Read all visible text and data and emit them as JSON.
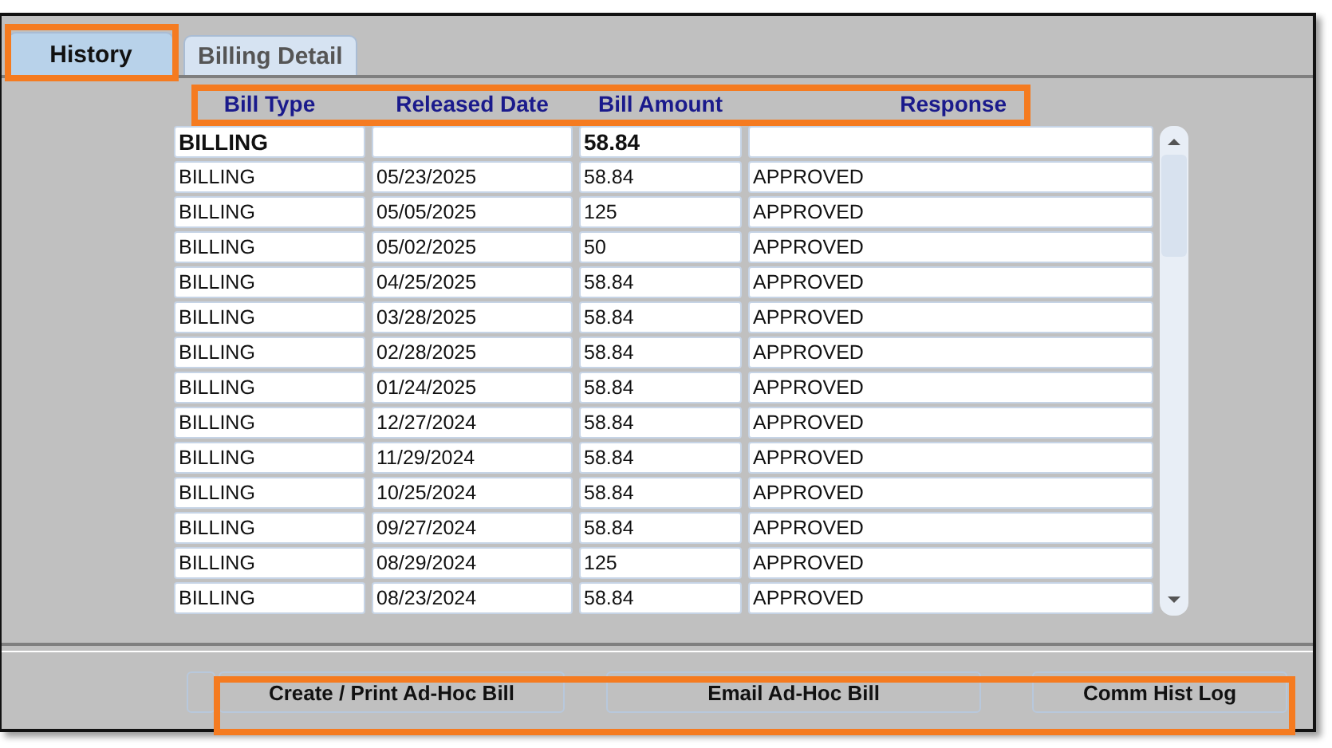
{
  "tabs": [
    {
      "label": "History",
      "selected": true
    },
    {
      "label": "Billing Detail",
      "selected": false
    }
  ],
  "table": {
    "columns": [
      "Bill Type",
      "Released Date",
      "Bill Amount",
      "Response"
    ],
    "rows": [
      {
        "bold": true,
        "cells": [
          "BILLING",
          "",
          "58.84",
          ""
        ]
      },
      {
        "bold": false,
        "cells": [
          "BILLING",
          "05/23/2025",
          "58.84",
          "APPROVED"
        ]
      },
      {
        "bold": false,
        "cells": [
          "BILLING",
          "05/05/2025",
          "125",
          "APPROVED"
        ]
      },
      {
        "bold": false,
        "cells": [
          "BILLING",
          "05/02/2025",
          "50",
          "APPROVED"
        ]
      },
      {
        "bold": false,
        "cells": [
          "BILLING",
          "04/25/2025",
          "58.84",
          "APPROVED"
        ]
      },
      {
        "bold": false,
        "cells": [
          "BILLING",
          "03/28/2025",
          "58.84",
          "APPROVED"
        ]
      },
      {
        "bold": false,
        "cells": [
          "BILLING",
          "02/28/2025",
          "58.84",
          "APPROVED"
        ]
      },
      {
        "bold": false,
        "cells": [
          "BILLING",
          "01/24/2025",
          "58.84",
          "APPROVED"
        ]
      },
      {
        "bold": false,
        "cells": [
          "BILLING",
          "12/27/2024",
          "58.84",
          "APPROVED"
        ]
      },
      {
        "bold": false,
        "cells": [
          "BILLING",
          "11/29/2024",
          "58.84",
          "APPROVED"
        ]
      },
      {
        "bold": false,
        "cells": [
          "BILLING",
          "10/25/2024",
          "58.84",
          "APPROVED"
        ]
      },
      {
        "bold": false,
        "cells": [
          "BILLING",
          "09/27/2024",
          "58.84",
          "APPROVED"
        ]
      },
      {
        "bold": false,
        "cells": [
          "BILLING",
          "08/29/2024",
          "125",
          "APPROVED"
        ]
      },
      {
        "bold": false,
        "cells": [
          "BILLING",
          "08/23/2024",
          "58.84",
          "APPROVED"
        ]
      }
    ]
  },
  "buttons": [
    "Create / Print Ad-Hoc Bill",
    "Email Ad-Hoc Bill",
    "Comm Hist Log"
  ]
}
